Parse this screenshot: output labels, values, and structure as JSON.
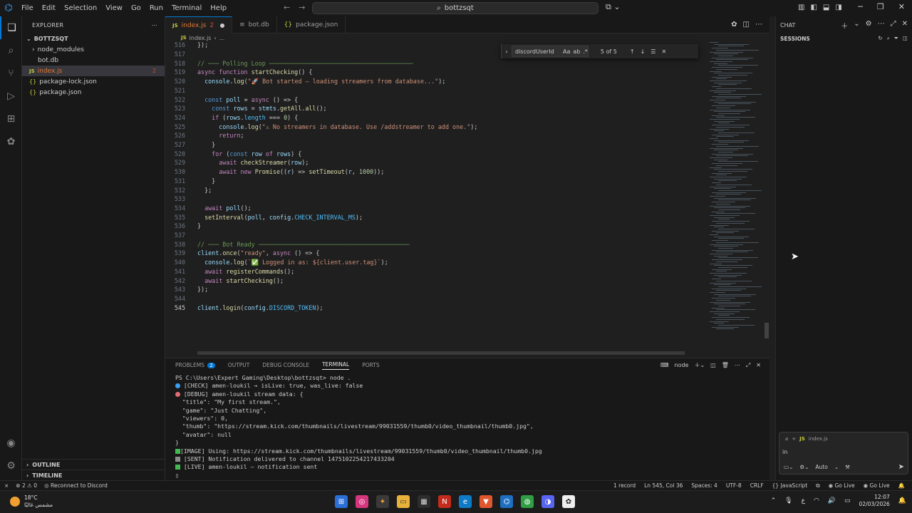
{
  "titlebar": {
    "menu": [
      "File",
      "Edit",
      "Selection",
      "View",
      "Go",
      "Run",
      "Terminal",
      "Help"
    ],
    "search": "bottzsqt"
  },
  "sidebar": {
    "title": "EXPLORER",
    "root": "BOTTZSQT",
    "items": [
      {
        "label": "node_modules"
      },
      {
        "label": "bot.db"
      },
      {
        "label": "index.js",
        "badge": "2"
      },
      {
        "label": "package-lock.json"
      },
      {
        "label": "package.json"
      }
    ],
    "outline": "OUTLINE",
    "timeline": "TIMELINE"
  },
  "tabs": [
    {
      "label": "index.js",
      "badge": "2"
    },
    {
      "label": "bot.db"
    },
    {
      "label": "package.json"
    }
  ],
  "breadcrumb": [
    "index.js",
    "..."
  ],
  "find": {
    "query": "discordUserId",
    "count": "5 of 5",
    "options": [
      "Aa",
      "ab",
      ".*"
    ]
  },
  "code_lines": [
    {
      "n": "516",
      "t": "});"
    },
    {
      "n": "517",
      "t": ""
    },
    {
      "n": "518",
      "t": "// ─── Polling Loop ────────────────────────────────────────"
    },
    {
      "n": "519",
      "t": "async function startChecking() {"
    },
    {
      "n": "520",
      "t": "  console.log(\"🚀 Bot started — loading streamers from database...\");"
    },
    {
      "n": "521",
      "t": ""
    },
    {
      "n": "522",
      "t": "  const poll = async () => {"
    },
    {
      "n": "523",
      "t": "    const rows = stmts.getAll.all();"
    },
    {
      "n": "524",
      "t": "    if (rows.length === 0) {"
    },
    {
      "n": "525",
      "t": "      console.log(\"⚠ No streamers in database. Use /addstreamer to add one.\");"
    },
    {
      "n": "526",
      "t": "      return;"
    },
    {
      "n": "527",
      "t": "    }"
    },
    {
      "n": "528",
      "t": "    for (const row of rows) {"
    },
    {
      "n": "529",
      "t": "      await checkStreamer(row);"
    },
    {
      "n": "530",
      "t": "      await new Promise((r) => setTimeout(r, 1000));"
    },
    {
      "n": "531",
      "t": "    }"
    },
    {
      "n": "532",
      "t": "  };"
    },
    {
      "n": "533",
      "t": ""
    },
    {
      "n": "534",
      "t": "  await poll();"
    },
    {
      "n": "535",
      "t": "  setInterval(poll, config.CHECK_INTERVAL_MS);"
    },
    {
      "n": "536",
      "t": "}"
    },
    {
      "n": "537",
      "t": ""
    },
    {
      "n": "538",
      "t": "// ─── Bot Ready ──────────────────────────────────────────"
    },
    {
      "n": "539",
      "t": "client.once(\"ready\", async () => {"
    },
    {
      "n": "540",
      "t": "  console.log(`✅ Logged in as: ${client.user.tag}`);"
    },
    {
      "n": "541",
      "t": "  await registerCommands();"
    },
    {
      "n": "542",
      "t": "  await startChecking();"
    },
    {
      "n": "543",
      "t": "});"
    },
    {
      "n": "544",
      "t": ""
    },
    {
      "n": "545",
      "t": "client.login(config.DISCORD_TOKEN);"
    }
  ],
  "panel": {
    "tabs": [
      "PROBLEMS",
      "OUTPUT",
      "DEBUG CONSOLE",
      "TERMINAL",
      "PORTS"
    ],
    "problems_count": "2",
    "shell": "node",
    "terminal_lines": [
      {
        "icon": "",
        "t": "PS C:\\Users\\Expert Gaming\\Desktop\\bottzsqt> node ."
      },
      {
        "icon": "check-dot",
        "t": " [CHECK] amen-loukil → isLive: true, was_live: false"
      },
      {
        "icon": "debug-dot",
        "t": " [DEBUG] amen-loukil stream data: {"
      },
      {
        "icon": "",
        "t": "  \"title\": \"My first stream.\","
      },
      {
        "icon": "",
        "t": "  \"game\": \"Just Chatting\","
      },
      {
        "icon": "",
        "t": "  \"viewers\": 0,"
      },
      {
        "icon": "",
        "t": "  \"thumb\": \"https://stream.kick.com/thumbnails/livestream/99031559/thumb0/video_thumbnail/thumb0.jpg\","
      },
      {
        "icon": "",
        "t": "  \"avatar\": null"
      },
      {
        "icon": "",
        "t": "}"
      },
      {
        "icon": "green-box",
        "t": "[IMAGE] Using: https://stream.kick.com/thumbnails/livestream/99031559/thumb0/video_thumbnail/thumb0.jpg"
      },
      {
        "icon": "gray-box",
        "t": " [SENT] Notification delivered to channel 1475102254217433204"
      },
      {
        "icon": "green-box",
        "t": " [LIVE] amen-loukil — notification sent"
      }
    ]
  },
  "chat": {
    "title": "CHAT",
    "sessions": "SESSIONS",
    "context_file": "index.js",
    "typed": "in",
    "mode": "Auto"
  },
  "statusbar": {
    "errors": "2",
    "warnings": "0",
    "discord": "Reconnect to Discord",
    "records": "1 record",
    "position": "Ln 545, Col 36",
    "spaces": "Spaces: 4",
    "encoding": "UTF-8",
    "eol": "CRLF",
    "language": "JavaScript",
    "golive1": "Go Live",
    "golive2": "Go Live"
  },
  "taskbar": {
    "temp": "18°C",
    "weather": "مشمس غالبًا",
    "time": "12:07",
    "date": "02/03/2026"
  },
  "colors": {
    "accent": "#0078d4",
    "error": "#c74e39",
    "tab_modified": "#e37933"
  }
}
